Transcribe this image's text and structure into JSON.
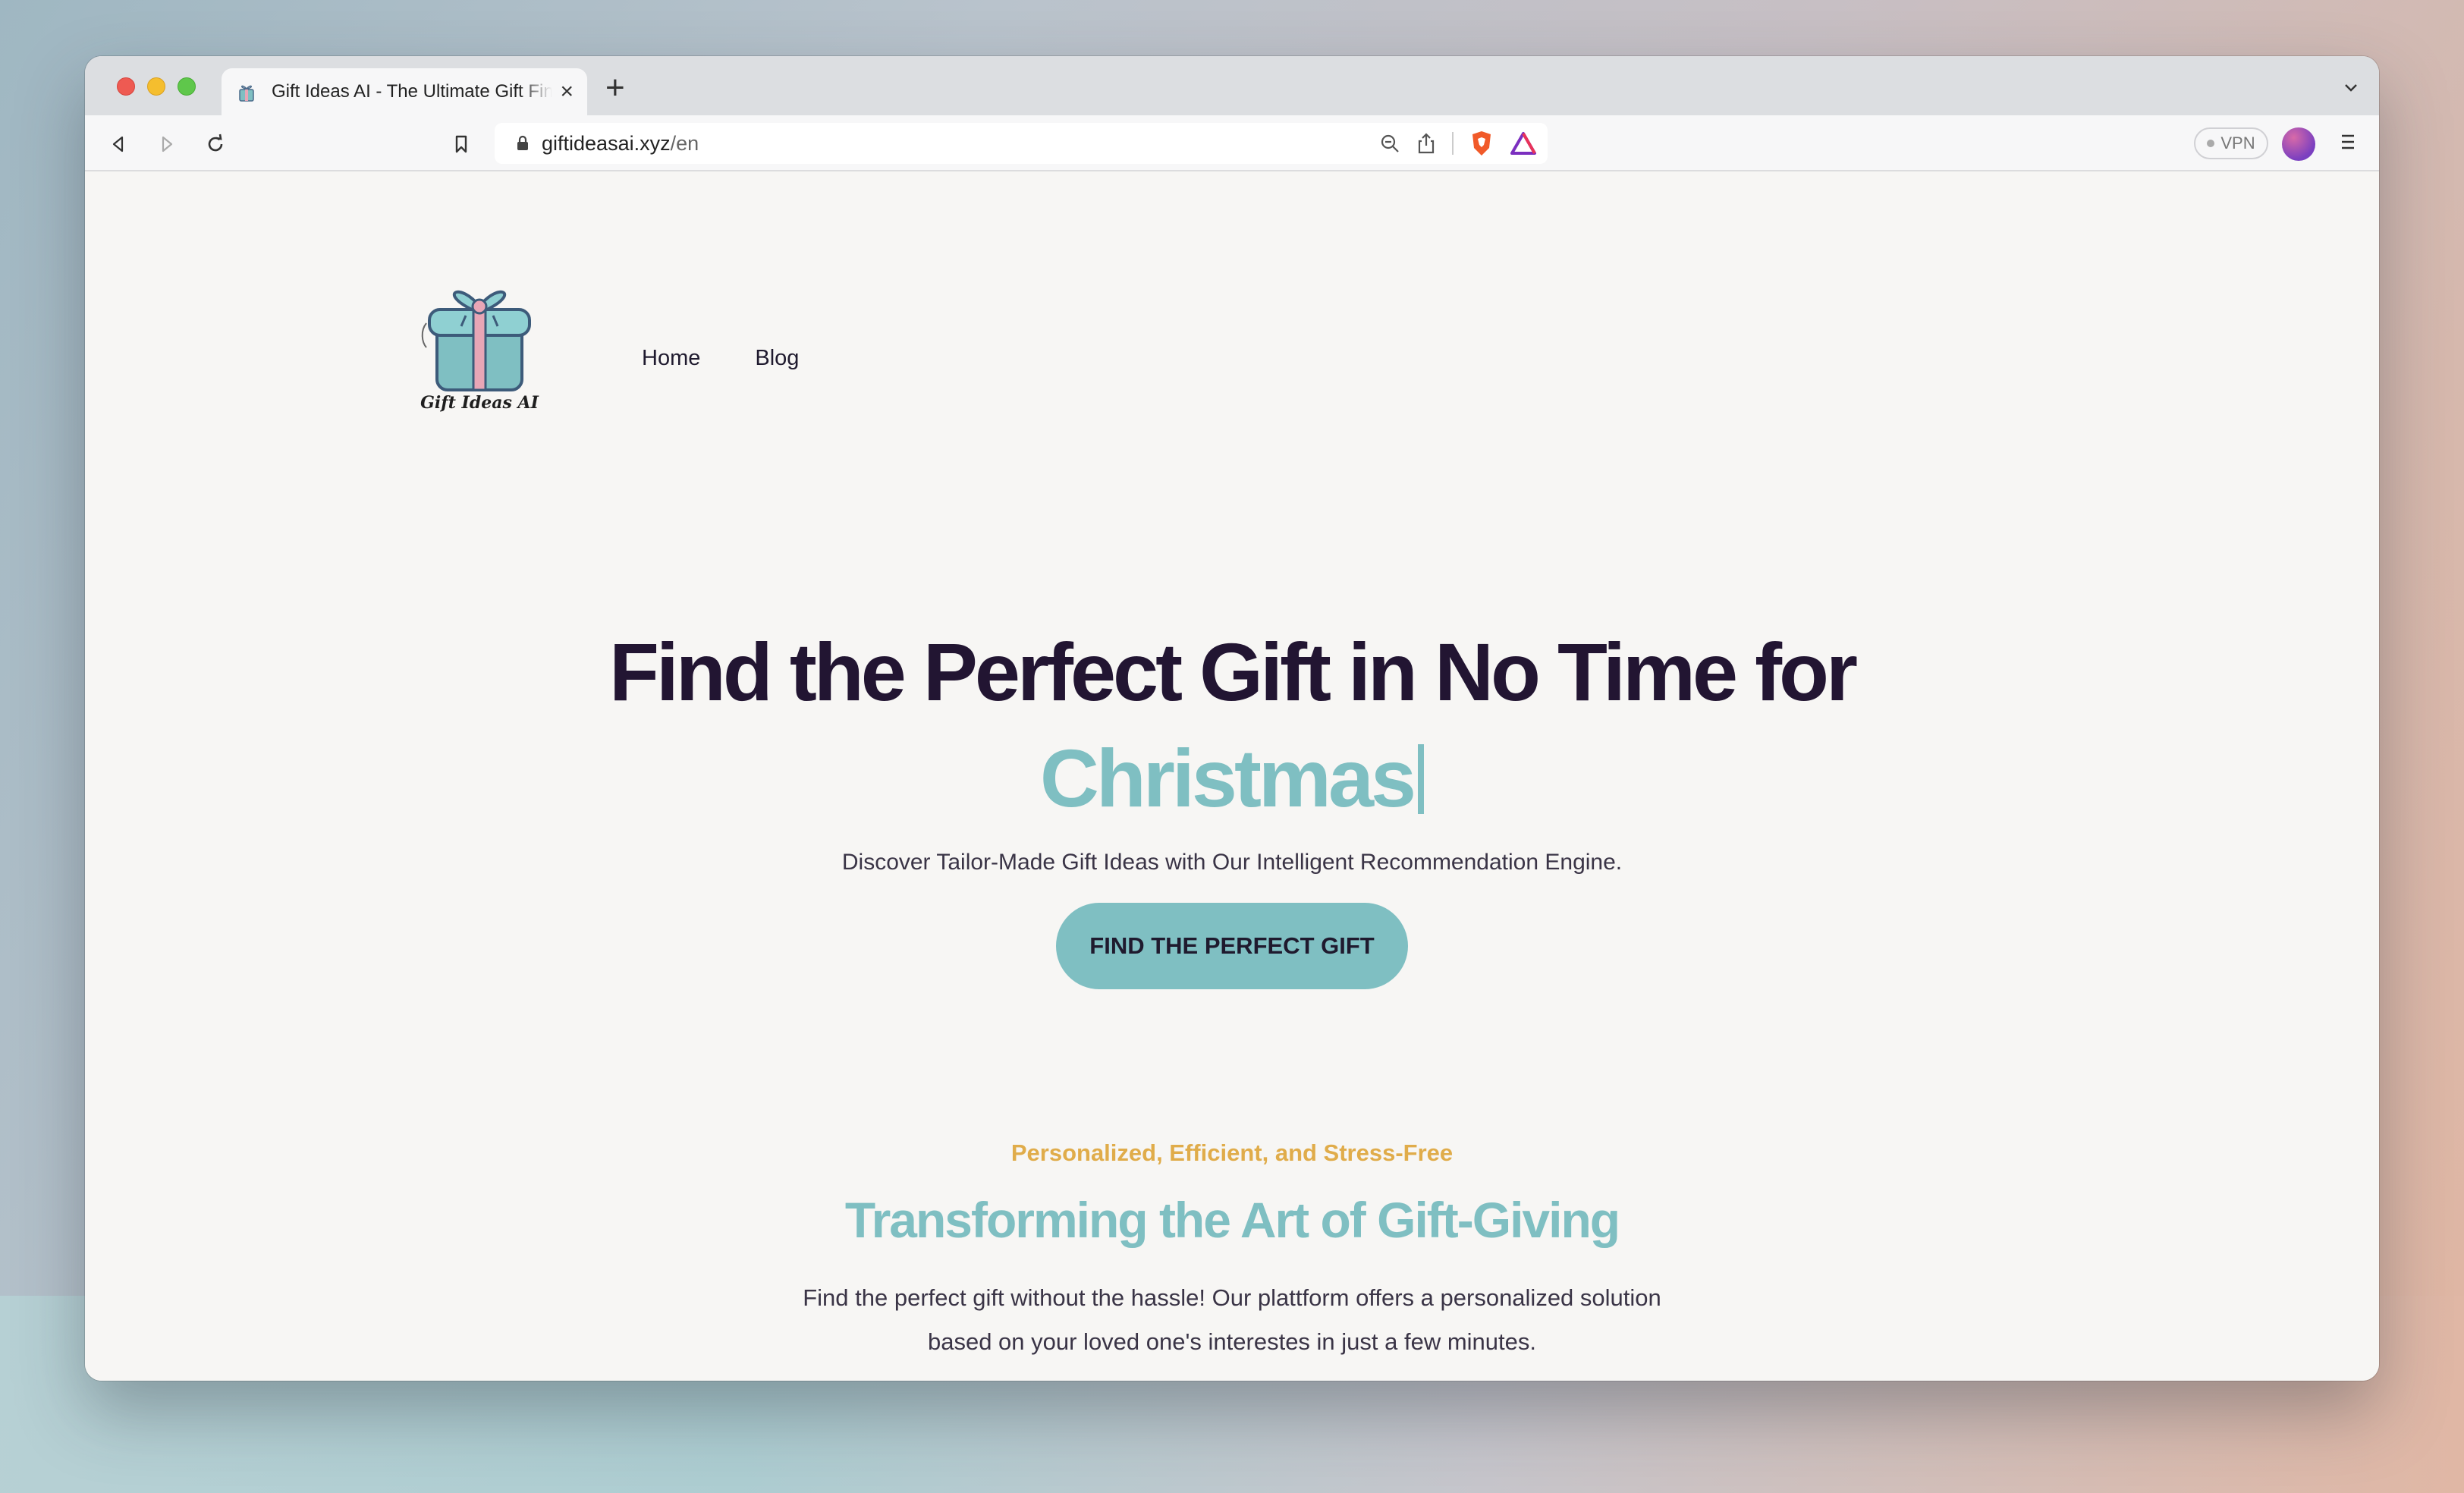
{
  "browser": {
    "tab_title": "Gift Ideas AI - The Ultimate Gift Finder",
    "url_host": "giftideasai.xyz",
    "url_path": "/en",
    "vpn_label": "VPN"
  },
  "site": {
    "logo_text": "Gift Ideas AI",
    "nav": [
      "Home",
      "Blog"
    ]
  },
  "hero": {
    "headline": "Find the Perfect Gift in No Time for",
    "headline_accent": "Christmas",
    "subtitle": "Discover Tailor-Made Gift Ideas with Our Intelligent Recommendation Engine.",
    "cta_label": "FIND THE PERFECT GIFT"
  },
  "features": {
    "eyebrow": "Personalized, Efficient, and Stress-Free",
    "title": "Transforming the Art of Gift-Giving",
    "body_line1": "Find the perfect gift without the hassle! Our plattform offers a personalized solution",
    "body_line2": "based on your loved one's interestes in just a few minutes."
  },
  "colors": {
    "accent_teal": "#7fbfc2",
    "heading_dark": "#221532",
    "eyebrow_gold": "#e0ac4a"
  }
}
